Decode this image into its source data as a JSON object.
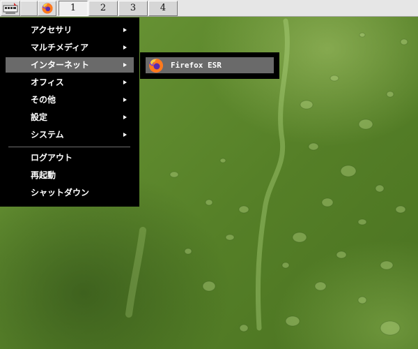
{
  "taskbar": {
    "launchers": [
      {
        "icon": "panel-menu-icon"
      },
      {
        "icon": "blank-launcher"
      },
      {
        "icon": "firefox-icon"
      }
    ],
    "workspaces": [
      {
        "label": "1",
        "active": true
      },
      {
        "label": "2",
        "active": false
      },
      {
        "label": "3",
        "active": false
      },
      {
        "label": "4",
        "active": false
      }
    ]
  },
  "menu": {
    "items": [
      {
        "label": "アクセサリ",
        "has_submenu": true
      },
      {
        "label": "マルチメディア",
        "has_submenu": true
      },
      {
        "label": "インターネット",
        "has_submenu": true,
        "selected": true
      },
      {
        "label": "オフィス",
        "has_submenu": true
      },
      {
        "label": "その他",
        "has_submenu": true
      },
      {
        "label": "設定",
        "has_submenu": true
      },
      {
        "label": "システム",
        "has_submenu": true
      }
    ],
    "actions": [
      {
        "label": "ログアウト"
      },
      {
        "label": "再起動"
      },
      {
        "label": "シャットダウン"
      }
    ]
  },
  "submenu": {
    "items": [
      {
        "label": "Firefox ESR",
        "icon": "firefox-icon",
        "selected": true
      }
    ]
  },
  "colors": {
    "menu_bg": "#000000",
    "selection_bg": "#6a6a6a",
    "taskbar_bg": "#e6e6e6"
  }
}
